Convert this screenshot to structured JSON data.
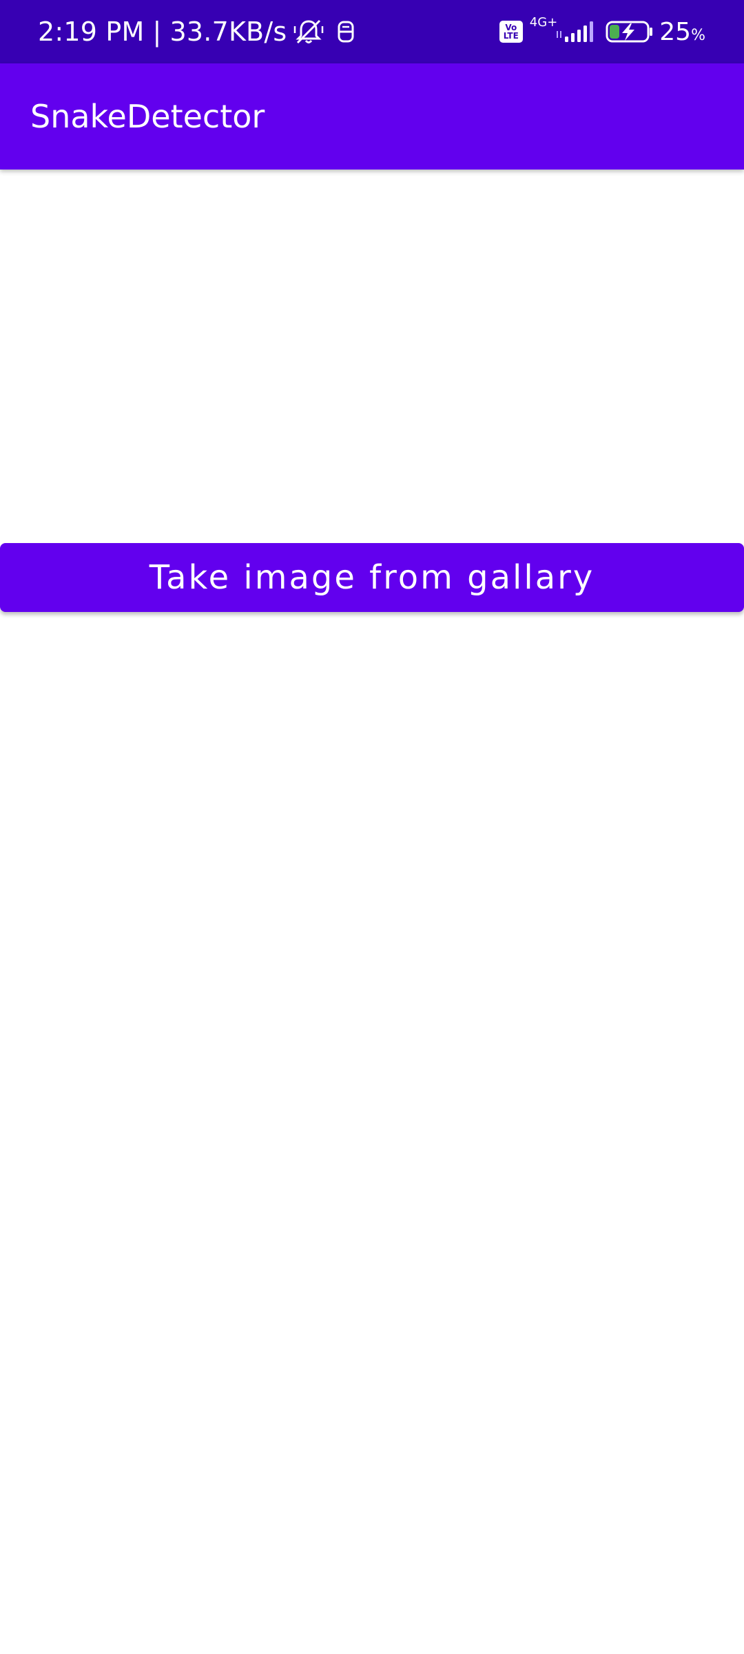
{
  "status_bar": {
    "time": "2:19 PM",
    "separator": "|",
    "net_speed": "33.7KB/s",
    "volte_top": "Vo",
    "volte_bottom": "LTE",
    "network_type": "4G+",
    "battery_level": "25",
    "battery_unit": "%",
    "icons": [
      "mute-bell-icon",
      "sim-icon",
      "volte-icon",
      "signal-icon",
      "battery-charging-icon"
    ]
  },
  "app_bar": {
    "title": "SnakeDetector"
  },
  "main": {
    "gallery_button_label": "Take image from gallary"
  },
  "colors": {
    "status_bar": "#3700b3",
    "primary": "#6200ee",
    "background": "#ffffff",
    "battery_fill": "#4caf50"
  }
}
